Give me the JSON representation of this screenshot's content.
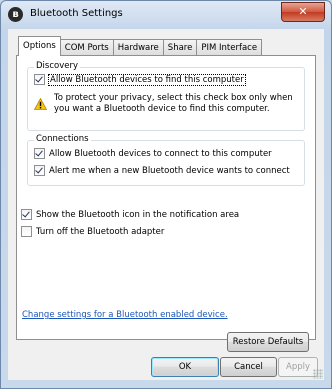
{
  "window": {
    "title": "Bluetooth Settings",
    "close_glyph": "✕",
    "icon": "bluetooth-icon"
  },
  "tabs": [
    "Options",
    "COM Ports",
    "Hardware",
    "Share",
    "PIM Interface"
  ],
  "discovery": {
    "label": "Discovery",
    "allow_find": {
      "label": "Allow Bluetooth devices to find this computer",
      "checked": true
    },
    "warning": "To protect your privacy, select this check box only when you want a Bluetooth device to find this computer."
  },
  "connections": {
    "label": "Connections",
    "allow_connect": {
      "label": "Allow Bluetooth devices to connect to this computer",
      "checked": true
    },
    "alert_connect": {
      "label": "Alert me when a new Bluetooth device wants to connect",
      "checked": true
    }
  },
  "show_icon": {
    "label": "Show the Bluetooth icon in the notification area",
    "checked": true
  },
  "turn_off": {
    "label": "Turn off the Bluetooth adapter",
    "checked": false
  },
  "change_settings_link": "Change settings for a Bluetooth enabled device.",
  "buttons": {
    "restore": "Restore Defaults",
    "ok": "OK",
    "cancel": "Cancel",
    "apply": "Apply"
  },
  "colors": {
    "link": "#1c56b8",
    "close": "#c13b22",
    "warning": "#f3c318"
  }
}
